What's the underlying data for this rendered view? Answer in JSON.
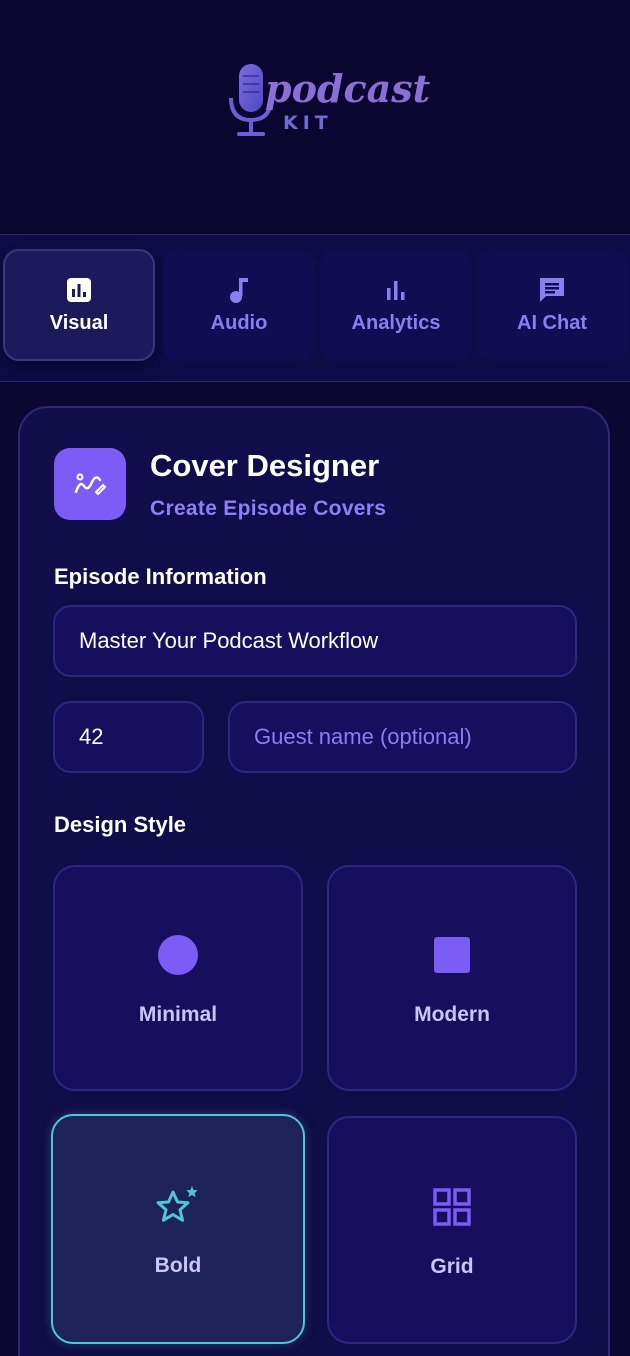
{
  "brand": {
    "logo_word": "podcast",
    "logo_sub": "KIT"
  },
  "tabs": [
    {
      "label": "Visual",
      "icon": "bar-chart-box-icon",
      "active": true
    },
    {
      "label": "Audio",
      "icon": "music-note-icon",
      "active": false
    },
    {
      "label": "Analytics",
      "icon": "bar-chart-icon",
      "active": false
    },
    {
      "label": "AI Chat",
      "icon": "chat-bubble-icon",
      "active": false
    }
  ],
  "card": {
    "icon": "design-pen-icon",
    "title": "Cover Designer",
    "subtitle": "Create Episode Covers",
    "episode_section": "Episode Information",
    "episode_title_value": "Master Your Podcast Workflow",
    "episode_number_value": "42",
    "guest_placeholder": "Guest name (optional)",
    "style_section": "Design Style",
    "styles": [
      {
        "label": "Minimal",
        "icon": "circle-icon",
        "selected": false
      },
      {
        "label": "Modern",
        "icon": "square-icon",
        "selected": false
      },
      {
        "label": "Bold",
        "icon": "star-sparkle-icon",
        "selected": true
      },
      {
        "label": "Grid",
        "icon": "grid-icon",
        "selected": false
      }
    ]
  },
  "colors": {
    "accent": "#7b5cf5",
    "selected_outline": "#4fc5d6",
    "background": "#0c0732"
  }
}
